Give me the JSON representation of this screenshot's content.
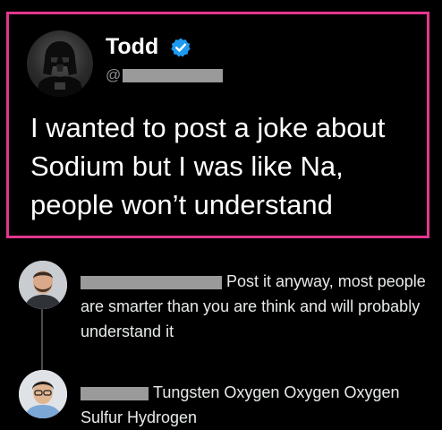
{
  "post": {
    "author_name": "Todd",
    "handle_prefix": "@",
    "text": "I wanted to post a joke about Sodium but I was like Na, people won’t understand",
    "highlight_color": "#e3368f",
    "verified_color": "#1d9bf0"
  },
  "replies": [
    {
      "text": "Post it anyway, most people are smarter than you are think and will probably understand it"
    },
    {
      "text": "Tungsten Oxygen Oxygen Oxygen Sulfur Hydrogen"
    }
  ],
  "icons": {
    "verified": "verified-badge-icon",
    "avatar": "darth-vader-avatar"
  }
}
